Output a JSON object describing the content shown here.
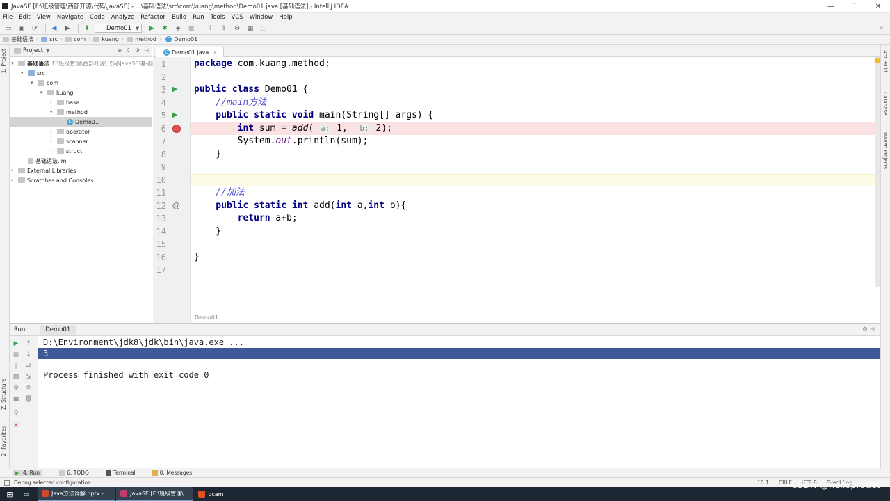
{
  "window": {
    "title": "JavaSE [F:\\班级管理\\西部开源\\代码\\JavaSE] - ...\\基础语法\\src\\com\\kuang\\method\\Demo01.java [基础语法] - IntelliJ IDEA",
    "min": "—",
    "max": "☐",
    "close": "✕"
  },
  "menu": [
    "File",
    "Edit",
    "View",
    "Navigate",
    "Code",
    "Analyze",
    "Refactor",
    "Build",
    "Run",
    "Tools",
    "VCS",
    "Window",
    "Help"
  ],
  "toolbar": {
    "run_config": "Demo01"
  },
  "breadcrumbs": [
    "基础语法",
    "src",
    "com",
    "kuang",
    "method",
    "Demo01"
  ],
  "left_strip": {
    "project": "1: Project",
    "structure": "Z: Structure",
    "favorites": "2: Favorites"
  },
  "right_strip": {
    "ant": "Ant Build",
    "database": "Database",
    "maven": "Maven Projects"
  },
  "project": {
    "header": "Project",
    "tree": [
      {
        "label": "基础语法",
        "extra": "F:\\班级管理\\西部开源\\代码\\JavaSE\\基础语法"
      },
      {
        "label": "src"
      },
      {
        "label": "com"
      },
      {
        "label": "kuang"
      },
      {
        "label": "base"
      },
      {
        "label": "method"
      },
      {
        "label": "Demo01"
      },
      {
        "label": "operator"
      },
      {
        "label": "scanner"
      },
      {
        "label": "struct"
      },
      {
        "label": "基础语法.iml"
      },
      {
        "label": "External Libraries"
      },
      {
        "label": "Scratches and Consoles"
      }
    ]
  },
  "editor": {
    "tab": "Demo01.java",
    "line_numbers": [
      "1",
      "2",
      "3",
      "4",
      "5",
      "6",
      "7",
      "8",
      "9",
      "10",
      "11",
      "12",
      "13",
      "14",
      "15",
      "16",
      "17"
    ],
    "lines": {
      "l1_kw": "package",
      "l1_rest": " com.kuang.method;",
      "l3_kw": "public class",
      "l3_rest": " Demo01 {",
      "l4_comment": "    //main方法",
      "l5_kw": "    public static void",
      "l5_rest": " main(String[] args) {",
      "l6_kw": "        int",
      "l6_a": " sum = ",
      "l6_add": "add",
      "l6_b": "( ",
      "l6_hint_a": "a:",
      "l6_c": " 1,  ",
      "l6_hint_b": "b:",
      "l6_d": " 2);",
      "l7_a": "        System.",
      "l7_out": "out",
      "l7_b": ".println(sum);",
      "l8": "    }",
      "l11_comment": "    //加法",
      "l12_kw": "    public static int",
      "l12_rest": " add(",
      "l12_kw2": "int",
      "l12_rest2": " a,",
      "l12_kw3": "int",
      "l12_rest3": " b){",
      "l13_kw": "        return",
      "l13_rest": " a+b;",
      "l14": "    }",
      "l16": "}"
    },
    "crumb": "Demo01",
    "override_marker": "@"
  },
  "run": {
    "header": "Run:",
    "config": "Demo01",
    "console": [
      "D:\\Environment\\jdk8\\jdk\\bin\\java.exe ...",
      "3",
      "Process finished with exit code 0"
    ]
  },
  "bottom_tabs": [
    "4: Run",
    "6: TODO",
    "Terminal",
    "0: Messages"
  ],
  "status": {
    "message": "Debug selected configuration",
    "pos": "10:1",
    "crlf": "CRLF",
    "enc": "UTF-8",
    "event_log": "Event Log"
  },
  "taskbar": {
    "start": "⊞",
    "items": [
      "Java方法详解.pptx - ...",
      "JavaSE [F:\\班级管理\\...",
      "ocam"
    ]
  },
  "watermark": "CSDN @helloprodet"
}
